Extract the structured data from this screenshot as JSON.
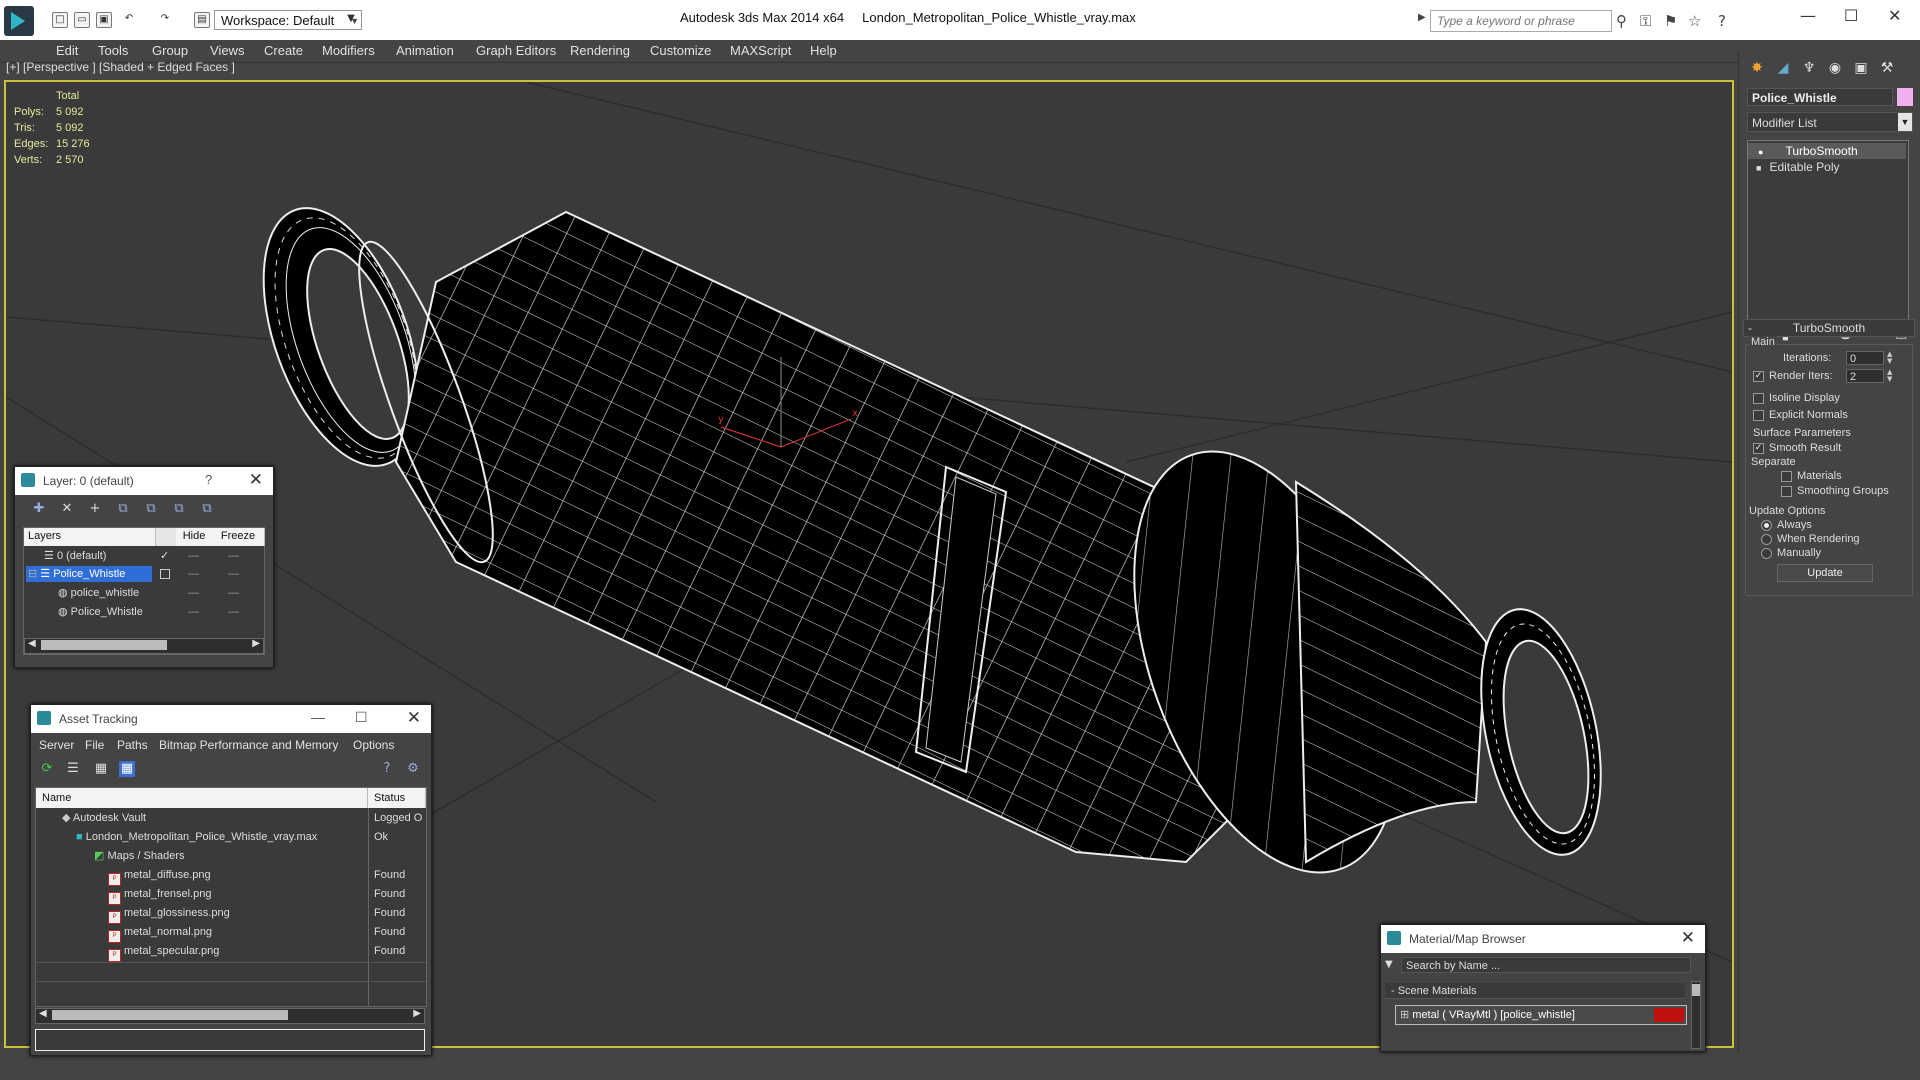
{
  "titlebar": {
    "workspace": "Workspace: Default",
    "app": "Autodesk 3ds Max  2014 x64",
    "file": "London_Metropolitan_Police_Whistle_vray.max",
    "search_placeholder": "Type a keyword or phrase"
  },
  "menu": [
    "Edit",
    "Tools",
    "Group",
    "Views",
    "Create",
    "Modifiers",
    "Animation",
    "Graph Editors",
    "Rendering",
    "Customize",
    "MAXScript",
    "Help"
  ],
  "viewport": {
    "label": "[+] [Perspective ] [Shaded + Edged Faces ]",
    "stats": {
      "header": "Total",
      "polys_label": "Polys:",
      "polys": "5 092",
      "tris_label": "Tris:",
      "tris": "5 092",
      "edges_label": "Edges:",
      "edges": "15 276",
      "verts_label": "Verts:",
      "verts": "2 570"
    }
  },
  "command_panel": {
    "object_name": "Police_Whistle",
    "object_color": "#f0b0f0",
    "modifier_list": "Modifier List",
    "stack": [
      "TurboSmooth",
      "Editable Poly"
    ],
    "turbosmooth": {
      "title": "TurboSmooth",
      "main": "Main",
      "iterations_label": "Iterations:",
      "iterations": "0",
      "render_iters_label": "Render Iters:",
      "render_iters": "2",
      "isoline": "Isoline Display",
      "explicit_normals": "Explicit Normals",
      "surface_params": "Surface Parameters",
      "smooth_result": "Smooth Result",
      "separate": "Separate",
      "materials": "Materials",
      "smoothing_groups": "Smoothing Groups",
      "update_options": "Update Options",
      "always": "Always",
      "when_rendering": "When Rendering",
      "manually": "Manually",
      "update_btn": "Update"
    }
  },
  "layer_window": {
    "title": "Layer: 0 (default)",
    "help": "?",
    "col_layers": "Layers",
    "col_hide": "Hide",
    "col_freeze": "Freeze",
    "rows": [
      "0 (default)",
      "Police_Whistle",
      "police_whistle",
      "Police_Whistle"
    ]
  },
  "asset_window": {
    "title": "Asset Tracking",
    "menu": [
      "Server",
      "File",
      "Paths",
      "Bitmap Performance and Memory",
      "Options"
    ],
    "col_name": "Name",
    "col_status": "Status",
    "rows": [
      {
        "name": "Autodesk Vault",
        "status": "Logged O"
      },
      {
        "name": "London_Metropolitan_Police_Whistle_vray.max",
        "status": "Ok"
      },
      {
        "name": "Maps / Shaders",
        "status": ""
      },
      {
        "name": "metal_diffuse.png",
        "status": "Found"
      },
      {
        "name": "metal_frensel.png",
        "status": "Found"
      },
      {
        "name": "metal_glossiness.png",
        "status": "Found"
      },
      {
        "name": "metal_normal.png",
        "status": "Found"
      },
      {
        "name": "metal_specular.png",
        "status": "Found"
      }
    ]
  },
  "material_browser": {
    "title": "Material/Map Browser",
    "search": "Search by Name ...",
    "section": "- Scene Materials",
    "item": "metal  ( VRayMtl )  [police_whistle]"
  }
}
